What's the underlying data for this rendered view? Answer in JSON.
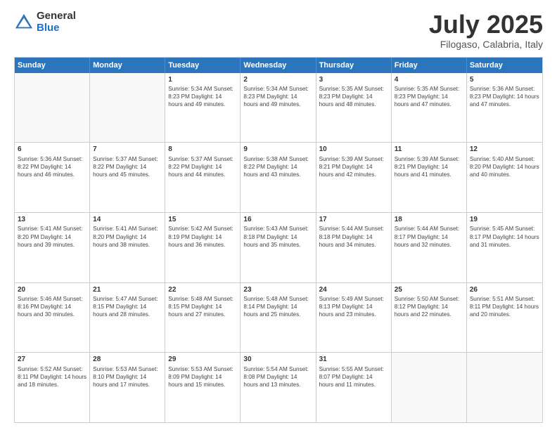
{
  "logo": {
    "general": "General",
    "blue": "Blue"
  },
  "header": {
    "month": "July 2025",
    "location": "Filogaso, Calabria, Italy"
  },
  "days": [
    "Sunday",
    "Monday",
    "Tuesday",
    "Wednesday",
    "Thursday",
    "Friday",
    "Saturday"
  ],
  "weeks": [
    [
      {
        "day": "",
        "content": ""
      },
      {
        "day": "",
        "content": ""
      },
      {
        "day": "1",
        "content": "Sunrise: 5:34 AM\nSunset: 8:23 PM\nDaylight: 14 hours and 49 minutes."
      },
      {
        "day": "2",
        "content": "Sunrise: 5:34 AM\nSunset: 8:23 PM\nDaylight: 14 hours and 49 minutes."
      },
      {
        "day": "3",
        "content": "Sunrise: 5:35 AM\nSunset: 8:23 PM\nDaylight: 14 hours and 48 minutes."
      },
      {
        "day": "4",
        "content": "Sunrise: 5:35 AM\nSunset: 8:23 PM\nDaylight: 14 hours and 47 minutes."
      },
      {
        "day": "5",
        "content": "Sunrise: 5:36 AM\nSunset: 8:23 PM\nDaylight: 14 hours and 47 minutes."
      }
    ],
    [
      {
        "day": "6",
        "content": "Sunrise: 5:36 AM\nSunset: 8:22 PM\nDaylight: 14 hours and 46 minutes."
      },
      {
        "day": "7",
        "content": "Sunrise: 5:37 AM\nSunset: 8:22 PM\nDaylight: 14 hours and 45 minutes."
      },
      {
        "day": "8",
        "content": "Sunrise: 5:37 AM\nSunset: 8:22 PM\nDaylight: 14 hours and 44 minutes."
      },
      {
        "day": "9",
        "content": "Sunrise: 5:38 AM\nSunset: 8:22 PM\nDaylight: 14 hours and 43 minutes."
      },
      {
        "day": "10",
        "content": "Sunrise: 5:39 AM\nSunset: 8:21 PM\nDaylight: 14 hours and 42 minutes."
      },
      {
        "day": "11",
        "content": "Sunrise: 5:39 AM\nSunset: 8:21 PM\nDaylight: 14 hours and 41 minutes."
      },
      {
        "day": "12",
        "content": "Sunrise: 5:40 AM\nSunset: 8:20 PM\nDaylight: 14 hours and 40 minutes."
      }
    ],
    [
      {
        "day": "13",
        "content": "Sunrise: 5:41 AM\nSunset: 8:20 PM\nDaylight: 14 hours and 39 minutes."
      },
      {
        "day": "14",
        "content": "Sunrise: 5:41 AM\nSunset: 8:20 PM\nDaylight: 14 hours and 38 minutes."
      },
      {
        "day": "15",
        "content": "Sunrise: 5:42 AM\nSunset: 8:19 PM\nDaylight: 14 hours and 36 minutes."
      },
      {
        "day": "16",
        "content": "Sunrise: 5:43 AM\nSunset: 8:18 PM\nDaylight: 14 hours and 35 minutes."
      },
      {
        "day": "17",
        "content": "Sunrise: 5:44 AM\nSunset: 8:18 PM\nDaylight: 14 hours and 34 minutes."
      },
      {
        "day": "18",
        "content": "Sunrise: 5:44 AM\nSunset: 8:17 PM\nDaylight: 14 hours and 32 minutes."
      },
      {
        "day": "19",
        "content": "Sunrise: 5:45 AM\nSunset: 8:17 PM\nDaylight: 14 hours and 31 minutes."
      }
    ],
    [
      {
        "day": "20",
        "content": "Sunrise: 5:46 AM\nSunset: 8:16 PM\nDaylight: 14 hours and 30 minutes."
      },
      {
        "day": "21",
        "content": "Sunrise: 5:47 AM\nSunset: 8:15 PM\nDaylight: 14 hours and 28 minutes."
      },
      {
        "day": "22",
        "content": "Sunrise: 5:48 AM\nSunset: 8:15 PM\nDaylight: 14 hours and 27 minutes."
      },
      {
        "day": "23",
        "content": "Sunrise: 5:48 AM\nSunset: 8:14 PM\nDaylight: 14 hours and 25 minutes."
      },
      {
        "day": "24",
        "content": "Sunrise: 5:49 AM\nSunset: 8:13 PM\nDaylight: 14 hours and 23 minutes."
      },
      {
        "day": "25",
        "content": "Sunrise: 5:50 AM\nSunset: 8:12 PM\nDaylight: 14 hours and 22 minutes."
      },
      {
        "day": "26",
        "content": "Sunrise: 5:51 AM\nSunset: 8:11 PM\nDaylight: 14 hours and 20 minutes."
      }
    ],
    [
      {
        "day": "27",
        "content": "Sunrise: 5:52 AM\nSunset: 8:11 PM\nDaylight: 14 hours and 18 minutes."
      },
      {
        "day": "28",
        "content": "Sunrise: 5:53 AM\nSunset: 8:10 PM\nDaylight: 14 hours and 17 minutes."
      },
      {
        "day": "29",
        "content": "Sunrise: 5:53 AM\nSunset: 8:09 PM\nDaylight: 14 hours and 15 minutes."
      },
      {
        "day": "30",
        "content": "Sunrise: 5:54 AM\nSunset: 8:08 PM\nDaylight: 14 hours and 13 minutes."
      },
      {
        "day": "31",
        "content": "Sunrise: 5:55 AM\nSunset: 8:07 PM\nDaylight: 14 hours and 11 minutes."
      },
      {
        "day": "",
        "content": ""
      },
      {
        "day": "",
        "content": ""
      }
    ]
  ]
}
